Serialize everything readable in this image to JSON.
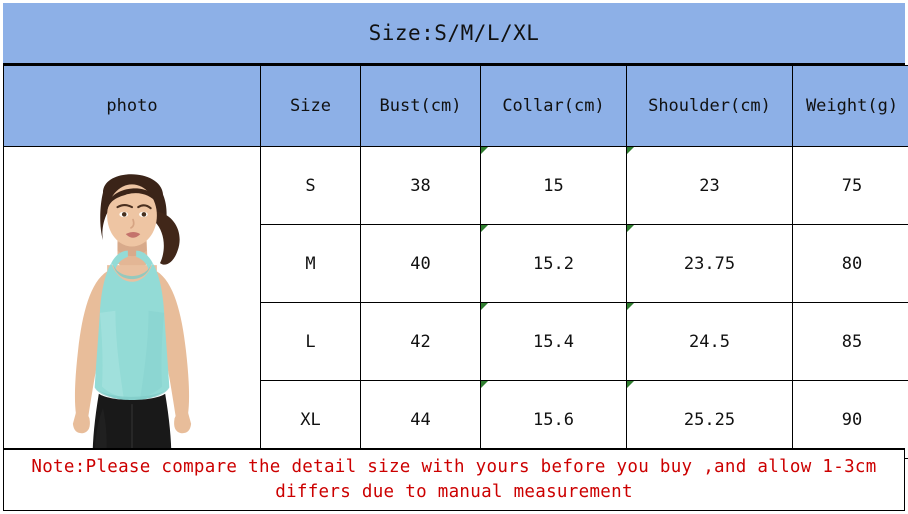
{
  "title": "Size:S/M/L/XL",
  "colors": {
    "header_blue": "#8db0e7",
    "note_red": "#cc0000",
    "border": "#000000",
    "garment_mint": "#8fd9d4",
    "leggings_black": "#1b1b1b"
  },
  "table": {
    "columns": [
      {
        "key": "photo",
        "label": "photo"
      },
      {
        "key": "size",
        "label": "Size"
      },
      {
        "key": "bust",
        "label": "Bust(cm)"
      },
      {
        "key": "collar",
        "label": "Collar(cm)"
      },
      {
        "key": "shoulder",
        "label": "Shoulder(cm)"
      },
      {
        "key": "weight",
        "label": "Weight(g)"
      }
    ],
    "rows": [
      {
        "size": "S",
        "bust": "38",
        "collar": "15",
        "shoulder": "23",
        "weight": "75"
      },
      {
        "size": "M",
        "bust": "40",
        "collar": "15.2",
        "shoulder": "23.75",
        "weight": "80"
      },
      {
        "size": "L",
        "bust": "42",
        "collar": "15.4",
        "shoulder": "24.5",
        "weight": "85"
      },
      {
        "size": "XL",
        "bust": "44",
        "collar": "15.6",
        "shoulder": "25.25",
        "weight": "90"
      }
    ]
  },
  "photo": {
    "alt": "woman wearing mint racerback tank top and black leggings"
  },
  "note": "Note:Please compare the detail size with yours before you buy ,and allow 1-3cm differs due to manual measurement",
  "chart_data": {
    "type": "table",
    "title": "Size:S/M/L/XL",
    "categories": [
      "S",
      "M",
      "L",
      "XL"
    ],
    "series": [
      {
        "name": "Bust(cm)",
        "values": [
          38,
          40,
          42,
          44
        ]
      },
      {
        "name": "Collar(cm)",
        "values": [
          15,
          15.2,
          15.4,
          15.6
        ]
      },
      {
        "name": "Shoulder(cm)",
        "values": [
          23,
          23.75,
          24.5,
          25.25
        ]
      },
      {
        "name": "Weight(g)",
        "values": [
          75,
          80,
          85,
          90
        ]
      }
    ],
    "xlabel": "Size",
    "ylabel": "",
    "annotations": [
      "Note:Please compare the detail size with yours before you buy ,and allow 1-3cm differs due to manual measurement"
    ]
  }
}
